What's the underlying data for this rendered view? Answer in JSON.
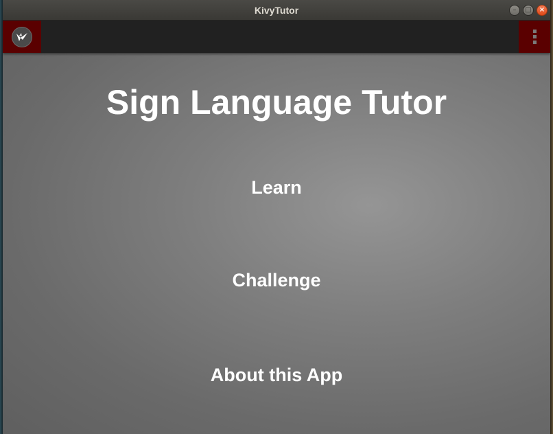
{
  "window": {
    "title": "KivyTutor",
    "controls": [
      "minimize-icon",
      "maximize-icon",
      "close-icon"
    ]
  },
  "toolbar": {
    "left_icon": "kivy-logo-icon",
    "right_icon": "more-vert-icon"
  },
  "main": {
    "title": "Sign Language Tutor",
    "buttons": [
      {
        "label": "Learn"
      },
      {
        "label": "Challenge"
      },
      {
        "label": "About this App"
      }
    ]
  },
  "colors": {
    "toolbar_background": "#212121",
    "toolbar_accent": "#5a0000",
    "content_background": "#808080",
    "text": "#ffffff"
  }
}
